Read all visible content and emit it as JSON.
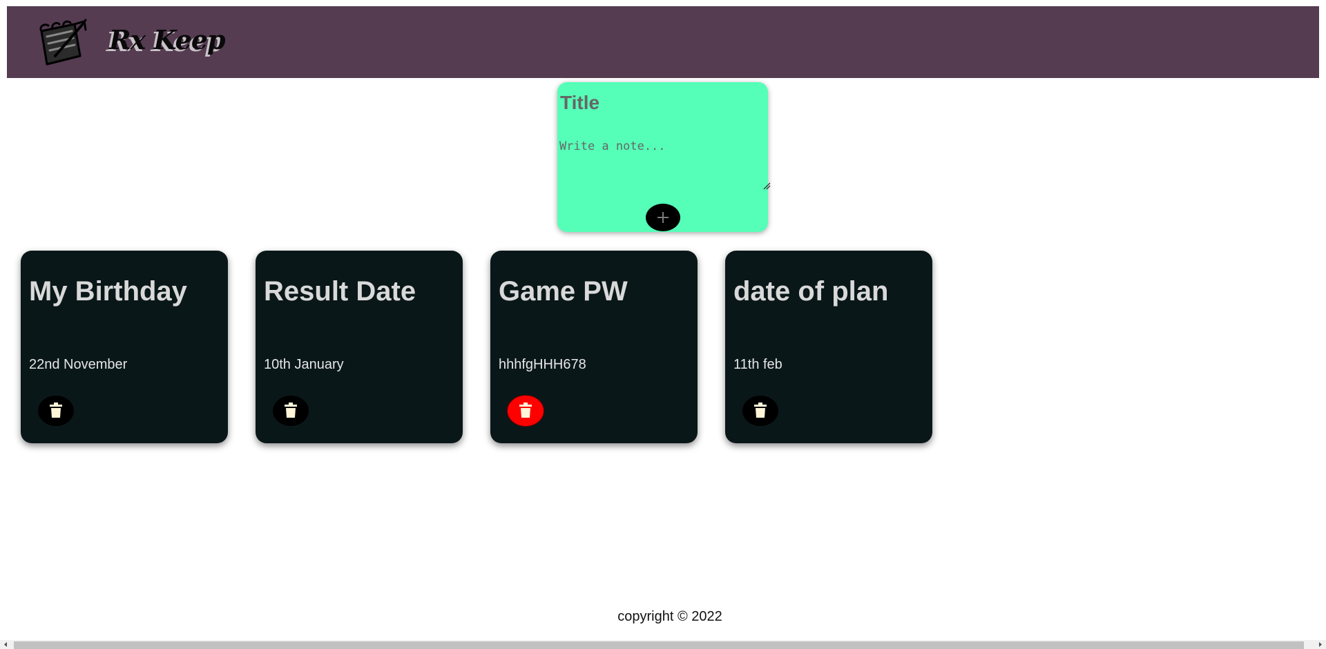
{
  "header": {
    "app_title": "Rx Keep",
    "logo_icon": "notepad-pen-icon"
  },
  "create_note": {
    "title_placeholder": "Title",
    "content_placeholder": "Write a note...",
    "add_icon": "plus-icon"
  },
  "notes": [
    {
      "title": "My Birthday",
      "content": "22nd November"
    },
    {
      "title": "Result Date",
      "content": "10th January"
    },
    {
      "title": "Game PW",
      "content": "hhhfgHHH678"
    },
    {
      "title": "date of plan",
      "content": "11th feb"
    }
  ],
  "delete_icon": "trash-icon",
  "footer": {
    "copyright": "copyright © 2022"
  },
  "colors": {
    "header_bg": "#553c51",
    "create_card_bg": "#55ffb8",
    "note_card_bg": "#0a1719",
    "delete_hover": "#ff0000"
  }
}
